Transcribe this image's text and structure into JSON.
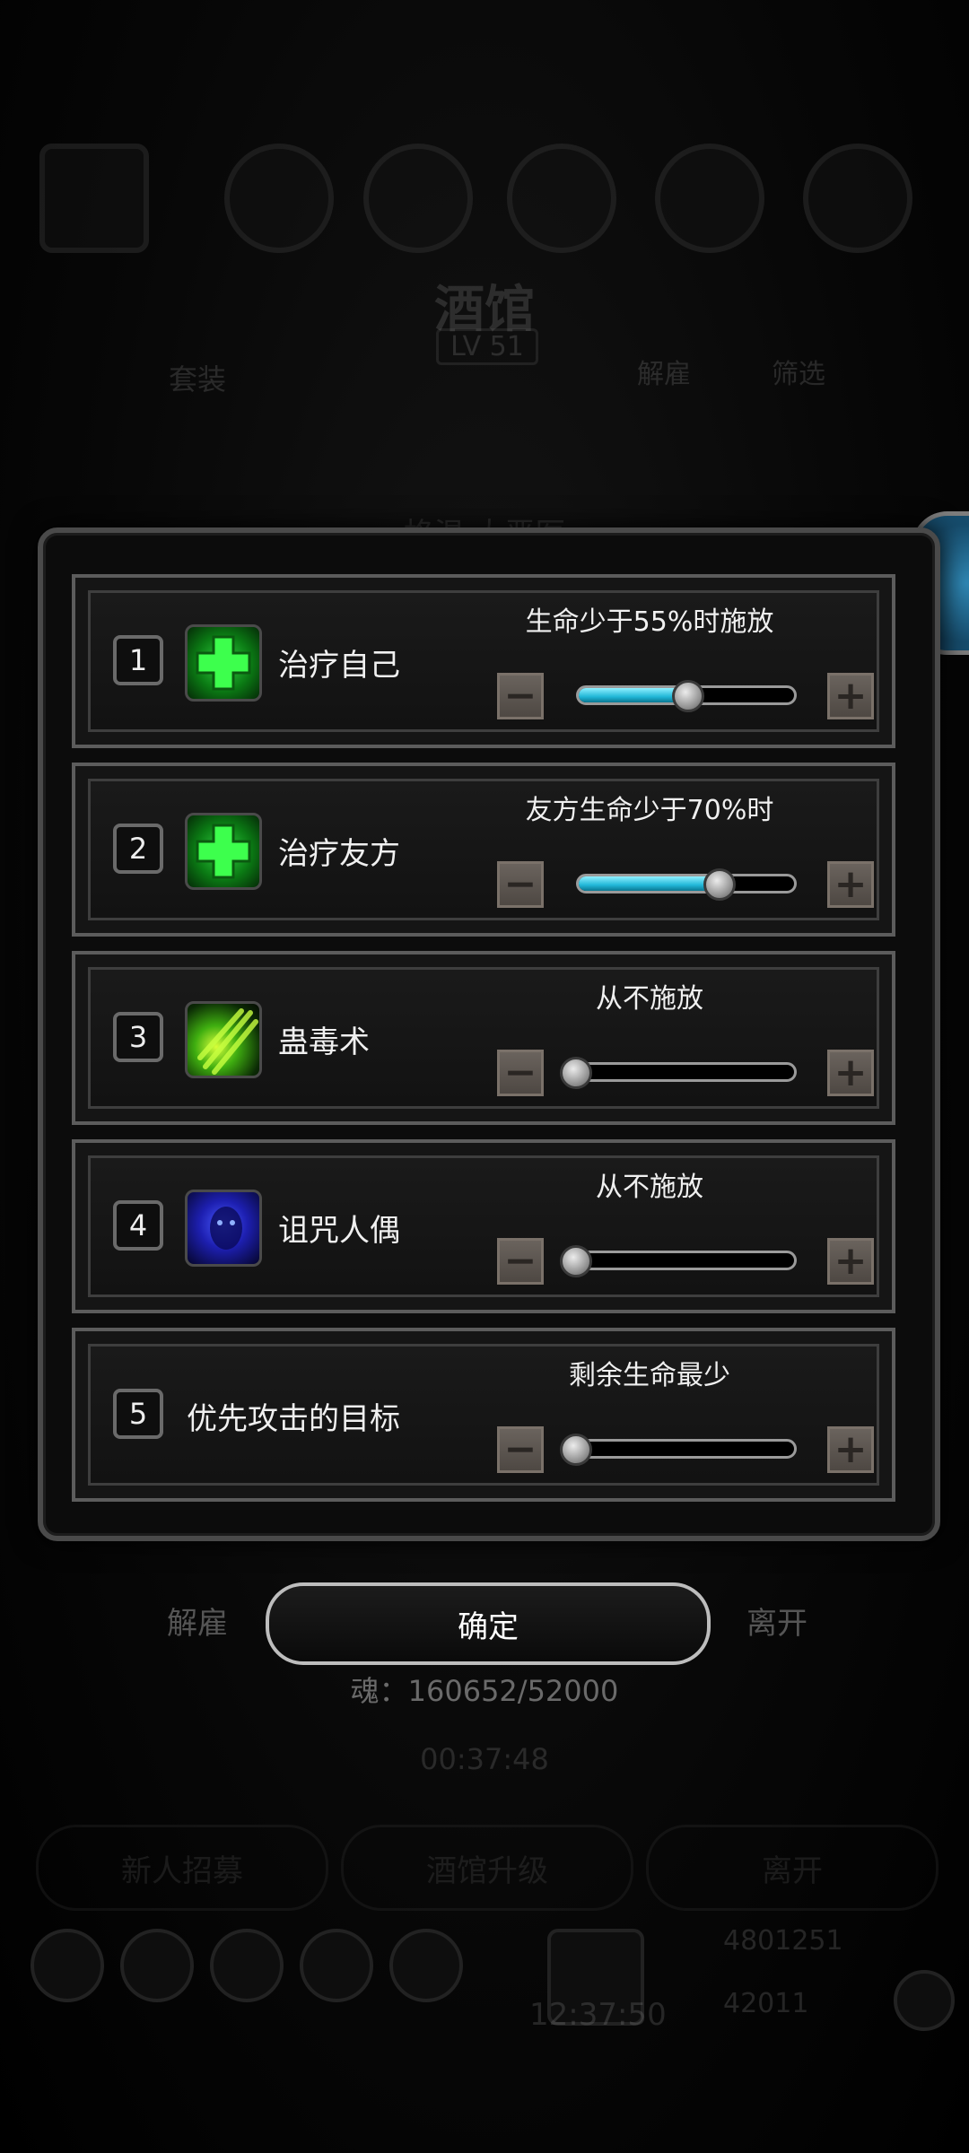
{
  "background": {
    "hero_name": "酒馆",
    "level": "LV 51",
    "tab_left": "套装",
    "tab_right_1": "解雇",
    "tab_right_2": "筛选",
    "hero_title": "格温·大恶医",
    "timer": "00:37:48",
    "bottom_buttons": [
      "新人招募",
      "酒馆升级",
      "离开"
    ],
    "clock": "12:37:50",
    "currency_1": "4801251",
    "currency_2": "42011"
  },
  "skills": [
    {
      "index": "1",
      "name": "治疗自己",
      "icon": "green-cross-icon",
      "condition": "生命少于55%时施放",
      "slider_fraction": 0.55
    },
    {
      "index": "2",
      "name": "治疗友方",
      "icon": "green-cross-icon",
      "condition": "友方生命少于70%时",
      "slider_fraction": 0.7
    },
    {
      "index": "3",
      "name": "蛊毒术",
      "icon": "poison-claw-icon",
      "condition": "从不施放",
      "slider_fraction": 0
    },
    {
      "index": "4",
      "name": "诅咒人偶",
      "icon": "curse-doll-icon",
      "condition": "从不施放",
      "slider_fraction": 0
    },
    {
      "index": "5",
      "name": "优先攻击的目标",
      "icon": "",
      "condition": "剩余生命最少",
      "slider_fraction": 0
    }
  ],
  "buttons": {
    "dismiss": "解雇",
    "confirm": "确定",
    "leave": "离开",
    "minus": "−",
    "plus": "+"
  },
  "soul_text": "魂：160652/52000",
  "colors": {
    "slider_fill": "#21b7d8",
    "heal_green": "#2fd140",
    "border_gray": "#5c5c5c"
  }
}
